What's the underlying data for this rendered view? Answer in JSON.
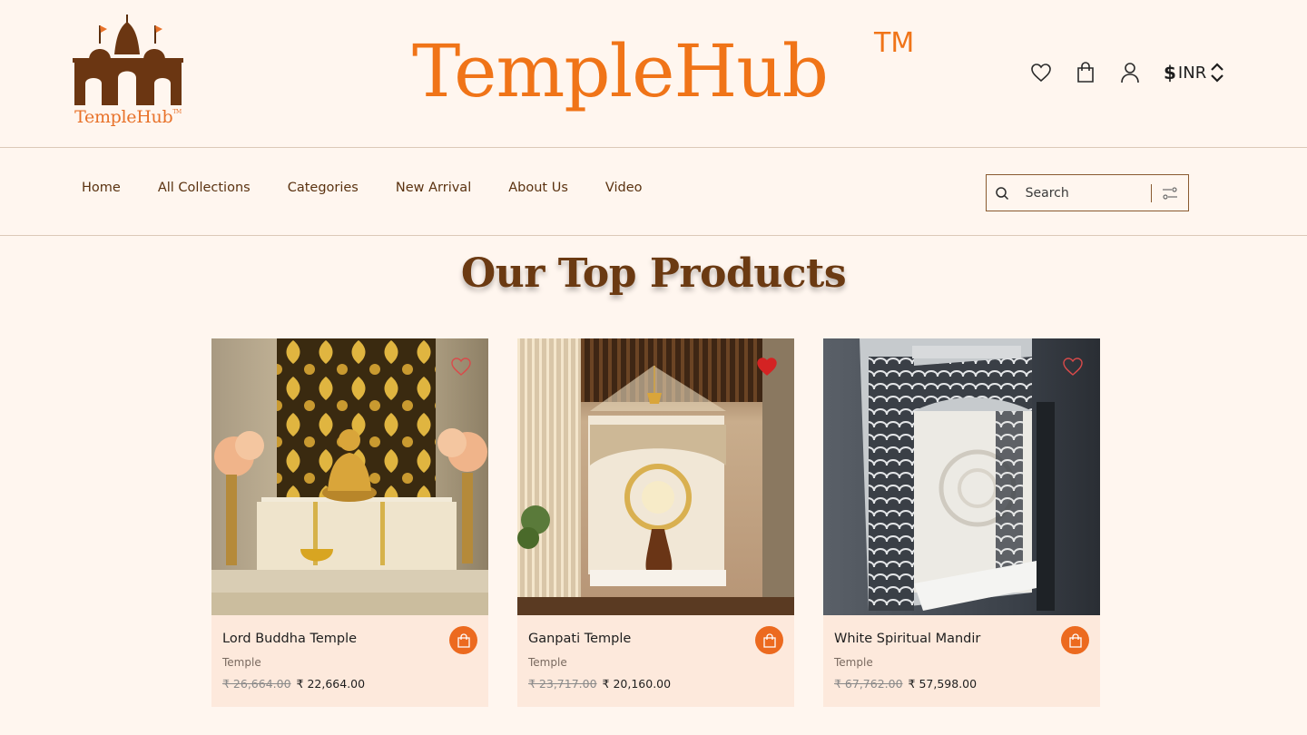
{
  "header": {
    "logo_text": "TempleHub",
    "logo_tm": "TM",
    "brand": "TempleHub",
    "brand_tm": "TM",
    "currency_symbol": "$",
    "currency_code": "INR",
    "icons": [
      "heart-icon",
      "shopping-bag-icon",
      "user-icon",
      "chevron-up-down-icon"
    ]
  },
  "nav": {
    "items": [
      {
        "label": "Home"
      },
      {
        "label": "All Collections"
      },
      {
        "label": "Categories"
      },
      {
        "label": "New Arrival"
      },
      {
        "label": "About Us"
      },
      {
        "label": "Video"
      }
    ],
    "search_placeholder": "Search"
  },
  "section_title": "Our Top Products",
  "products": [
    {
      "name": "Lord Buddha Temple",
      "category": "Temple",
      "old_price": "₹ 26,664.00",
      "price": "₹ 22,664.00",
      "wishlisted": false
    },
    {
      "name": "Ganpati Temple",
      "category": "Temple",
      "old_price": "₹ 23,717.00",
      "price": "₹ 20,160.00",
      "wishlisted": true
    },
    {
      "name": "White Spiritual Mandir",
      "category": "Temple",
      "old_price": "₹ 67,762.00",
      "price": "₹ 57,598.00",
      "wishlisted": false
    }
  ],
  "colors": {
    "background": "#fff6ef",
    "brand_orange": "#f07418",
    "brown": "#6b3a12",
    "card_bg": "#fde9dc",
    "cart_button": "#ec6a1f",
    "wishlist_active": "#d42323"
  }
}
